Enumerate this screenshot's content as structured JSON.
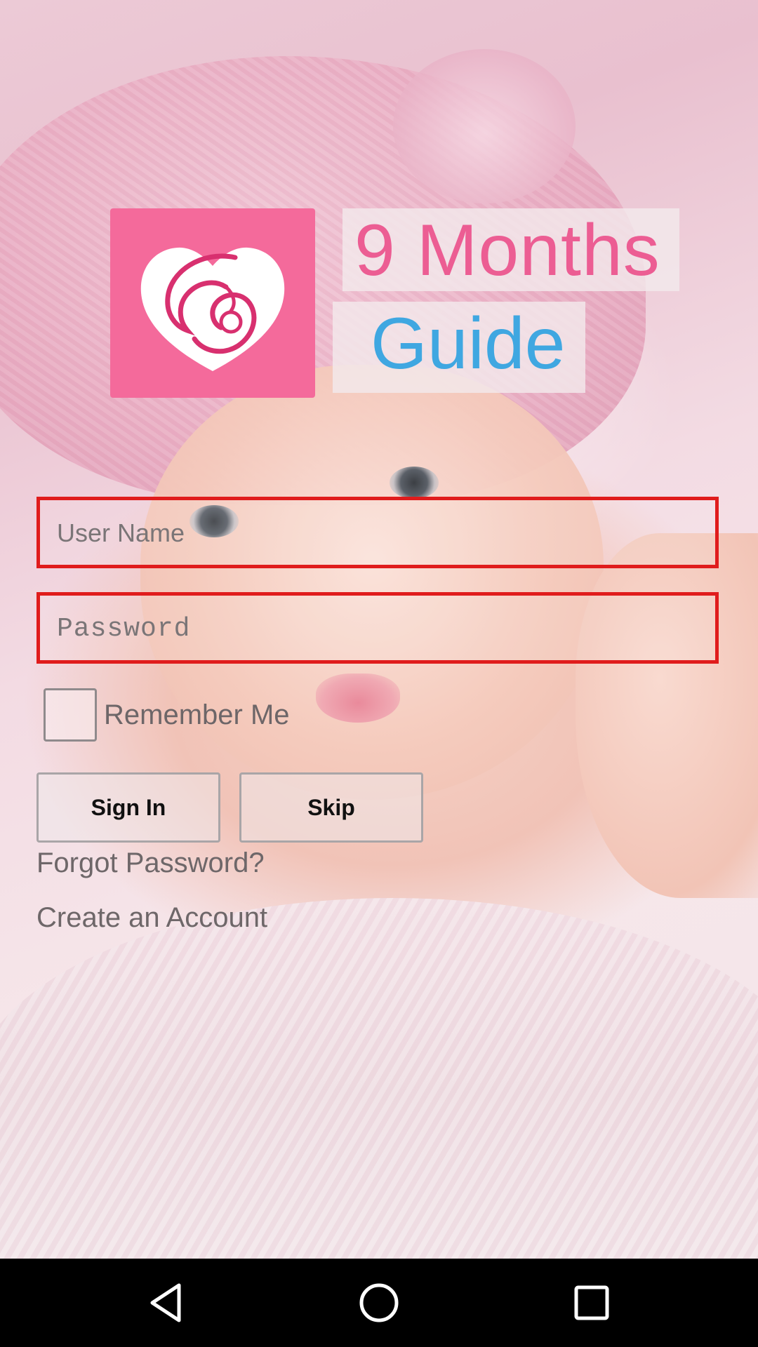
{
  "app": {
    "title_line1": "9 Months",
    "title_line2": "Guide",
    "logo_icon": "mother-baby-heart-icon",
    "colors": {
      "logo_bg": "#f46a9b",
      "title_pink": "#ec5d93",
      "title_blue": "#3fa7e1",
      "field_border": "#e01c1c"
    }
  },
  "login": {
    "username": {
      "placeholder": "User Name",
      "value": ""
    },
    "password": {
      "placeholder": "Password",
      "value": ""
    },
    "remember_me": {
      "label": "Remember Me",
      "checked": false
    },
    "signin_label": "Sign In",
    "skip_label": "Skip",
    "forgot_label": "Forgot Password?",
    "create_label": "Create an Account"
  },
  "navbar": {
    "back_icon": "back-triangle-icon",
    "home_icon": "home-circle-icon",
    "recents_icon": "recents-square-icon"
  }
}
